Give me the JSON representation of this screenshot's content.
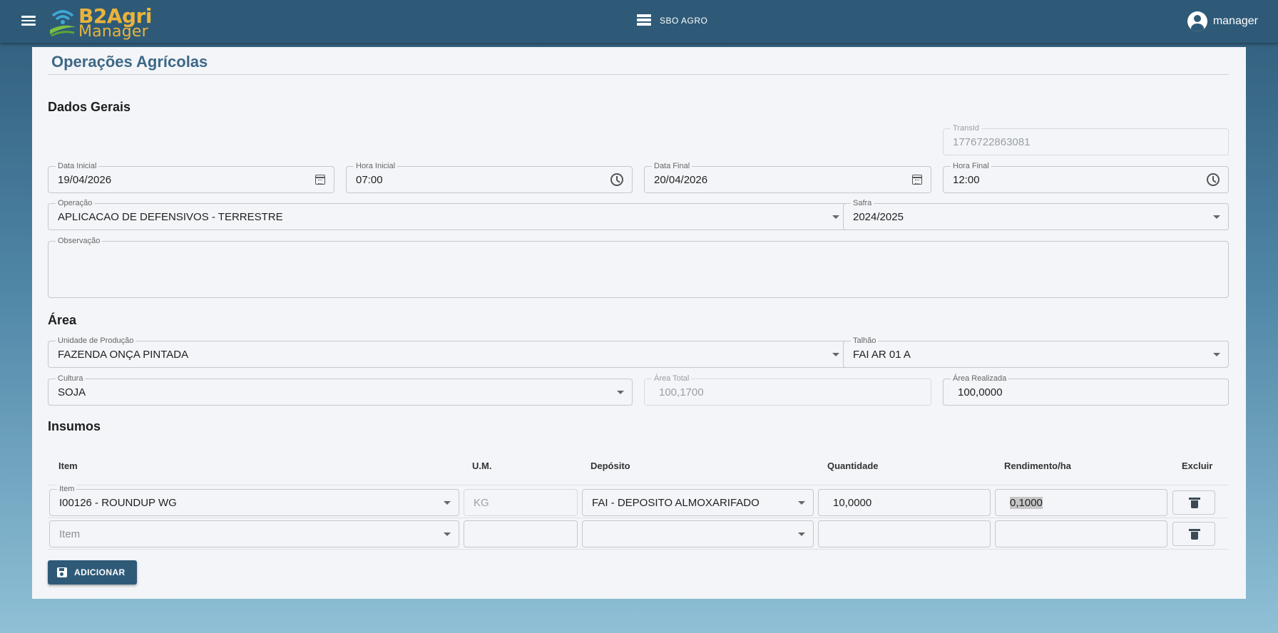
{
  "header": {
    "logo_line1": "B2Agri",
    "logo_line2": "Manager",
    "company": "SBO AGRO",
    "user": "manager"
  },
  "page": {
    "title": "Operações Agrícolas"
  },
  "dados_gerais": {
    "section": "Dados Gerais",
    "transid": {
      "label": "TransId",
      "value": "1776722863081"
    },
    "data_inicial": {
      "label": "Data Inicial",
      "value": "19/04/2026"
    },
    "hora_inicial": {
      "label": "Hora Inicial",
      "value": "07:00"
    },
    "data_final": {
      "label": "Data Final",
      "value": "20/04/2026"
    },
    "hora_final": {
      "label": "Hora Final",
      "value": "12:00"
    },
    "operacao": {
      "label": "Operação",
      "value": "APLICACAO DE DEFENSIVOS - TERRESTRE"
    },
    "safra": {
      "label": "Safra",
      "value": "2024/2025"
    },
    "observacao": {
      "label": "Observação",
      "value": ""
    }
  },
  "area": {
    "section": "Área",
    "unidade": {
      "label": "Unidade de Produção",
      "value": "FAZENDA ONÇA PINTADA"
    },
    "talhao": {
      "label": "Talhão",
      "value": "FAI AR 01 A"
    },
    "cultura": {
      "label": "Cultura",
      "value": "SOJA"
    },
    "area_total": {
      "label": "Área Total",
      "value": "100,1700"
    },
    "area_realizada": {
      "label": "Área Realizada",
      "value": "100,0000"
    }
  },
  "insumos": {
    "section": "Insumos",
    "columns": [
      "Item",
      "U.M.",
      "Depósito",
      "Quantidade",
      "Rendimento/ha",
      "Excluir"
    ],
    "rows": [
      {
        "item_label": "Item",
        "item": "I00126 - ROUNDUP WG",
        "um": "KG",
        "deposito": "FAI - DEPOSITO ALMOXARIFADO",
        "quantidade": "10,0000",
        "rendimento": "0,1000"
      },
      {
        "item_placeholder": "Item",
        "item": "",
        "um": "",
        "deposito": "",
        "quantidade": "",
        "rendimento": ""
      }
    ],
    "add_label": "ADICIONAR"
  }
}
